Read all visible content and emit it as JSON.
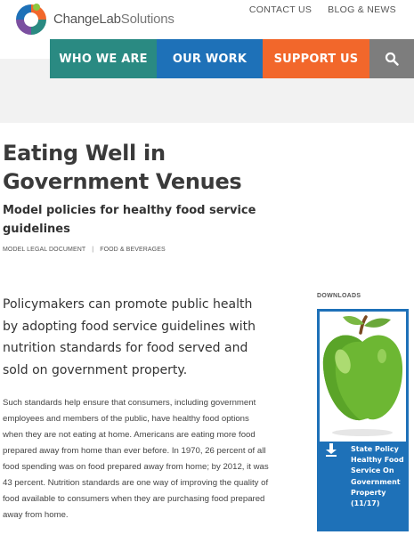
{
  "header": {
    "logo_text": "ChangeLab",
    "logo_text_light": "Solutions",
    "top_links": [
      "CONTACT US",
      "BLOG & NEWS"
    ]
  },
  "nav": {
    "items": [
      "WHO WE ARE",
      "OUR WORK",
      "SUPPORT US"
    ],
    "search_icon": "search-icon"
  },
  "page": {
    "title": "Eating Well in Government Venues",
    "subtitle": "Model policies for healthy food service guidelines",
    "meta": [
      "MODEL LEGAL DOCUMENT",
      "FOOD & BEVERAGES"
    ],
    "lead": "Policymakers can promote public health by adopting food service guidelines with nutrition standards for food served and sold on government property.",
    "body": "Such standards help ensure that consumers, including government employees and members of the public, have healthy food options when they are not eating at home. Americans are eating more food prepared away from home than ever before. In 1970, 26 percent of all food spending was on food prepared away from home; by 2012, it was 43 percent. Nutrition standards are one way of improving the quality of food available to consumers when they are purchasing food prepared away from home."
  },
  "downloads": {
    "label": "DOWNLOADS",
    "items": [
      {
        "title": "State Policy Healthy Food Service On Government Property (11/17)",
        "icon": "download-icon",
        "thumbnail": "green-apple"
      }
    ]
  },
  "colors": {
    "teal": "#2a8a82",
    "blue": "#1e71b8",
    "orange": "#f2672b",
    "gray": "#7d7d7d"
  }
}
